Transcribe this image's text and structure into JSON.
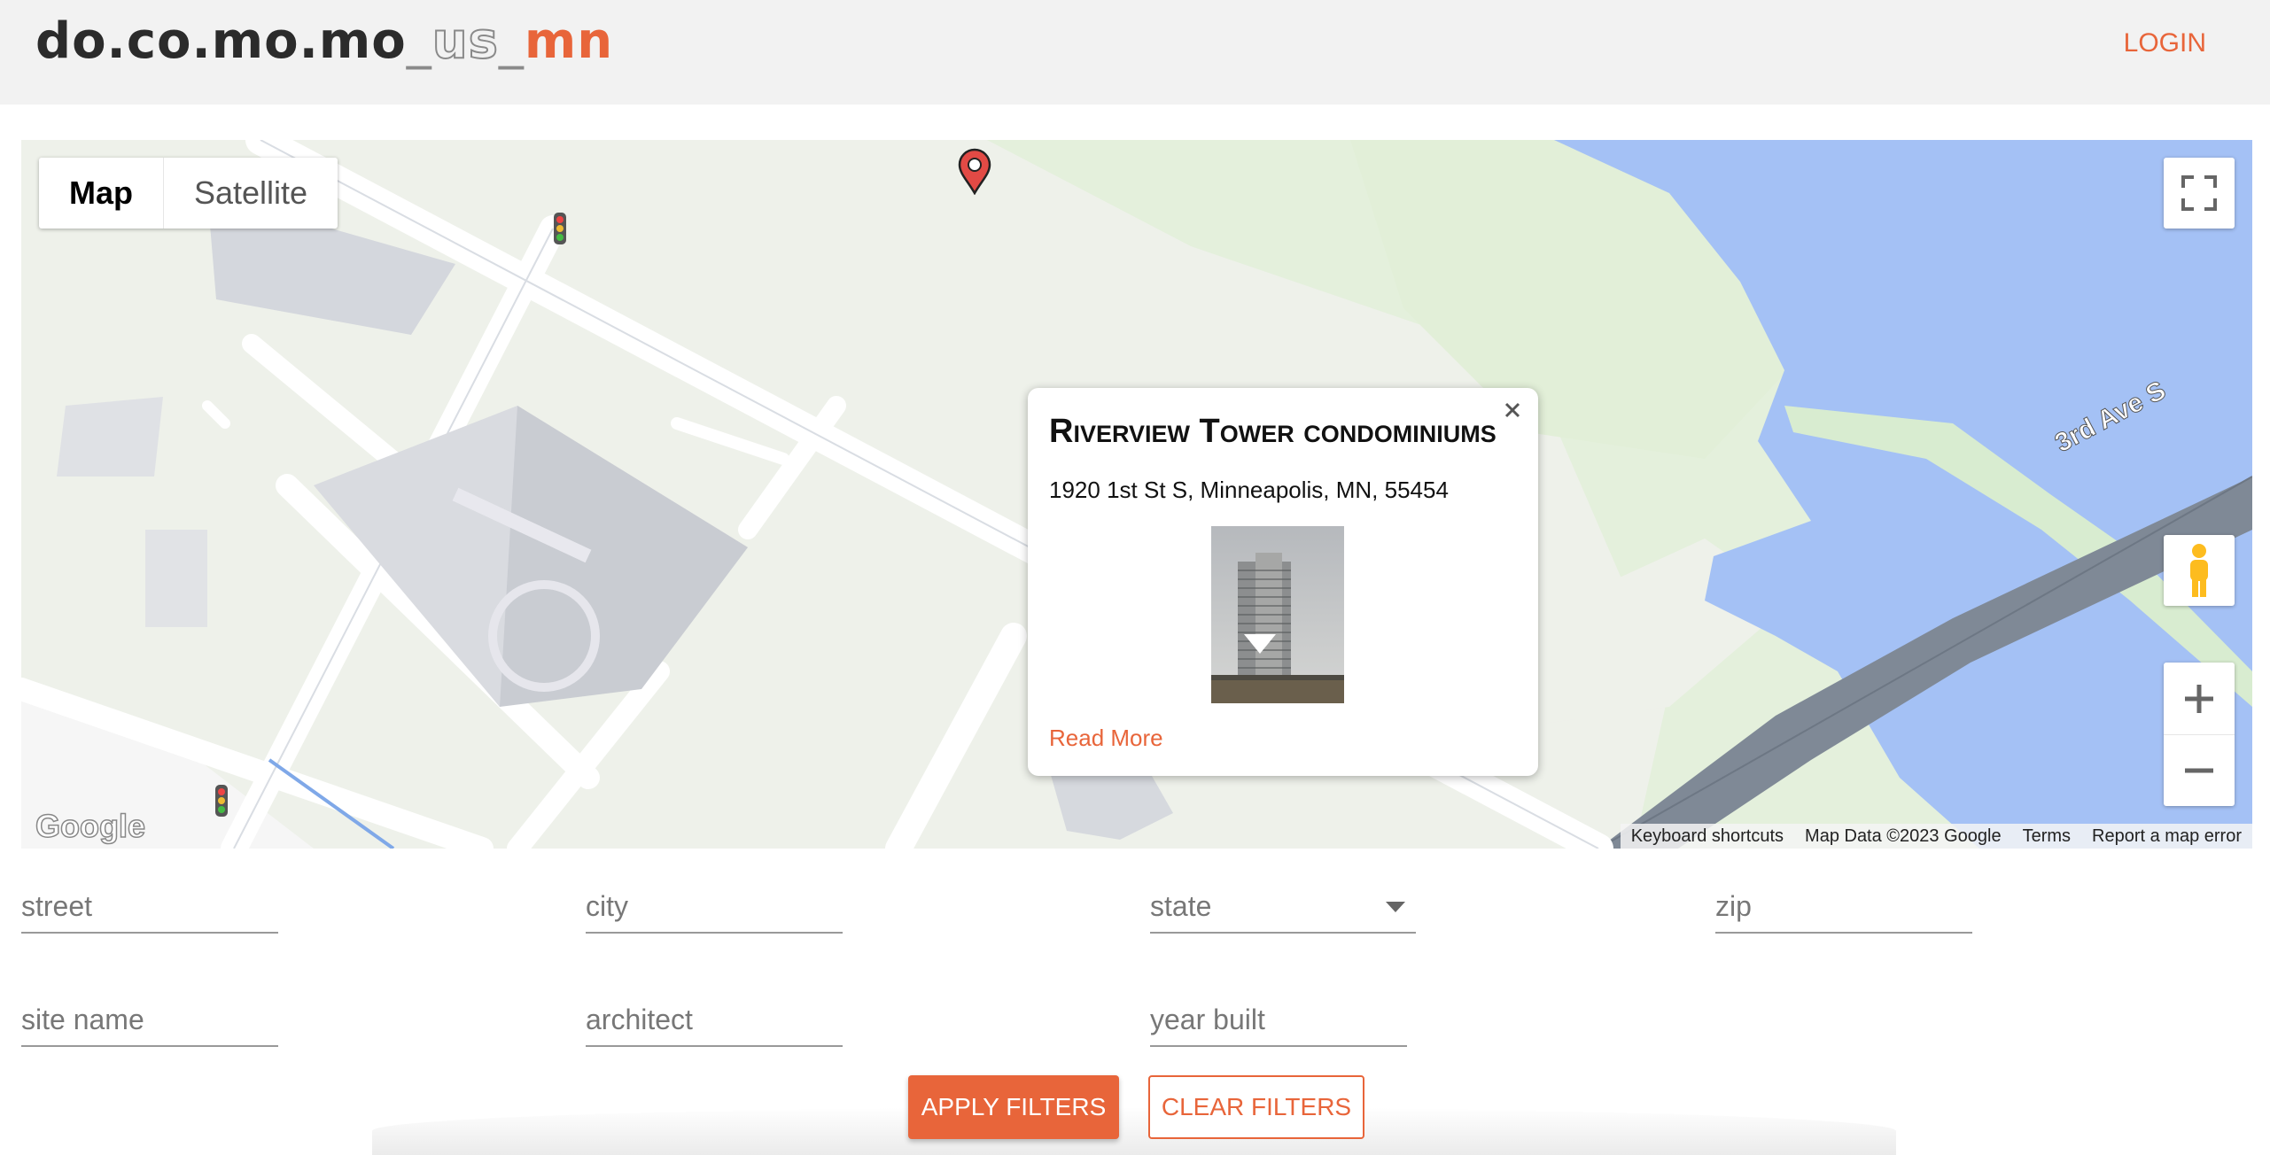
{
  "header": {
    "logo": {
      "docomomo": "do.co.mo.mo",
      "sep1": "_",
      "us": "us",
      "sep2": "_",
      "mn": "mn"
    },
    "login_label": "LOGIN"
  },
  "map": {
    "type_map": "Map",
    "type_satellite": "Satellite",
    "street_label": "3rd Ave S",
    "google_logo": "Google",
    "attribution": {
      "shortcuts": "Keyboard shortcuts",
      "data": "Map Data ©2023 Google",
      "terms": "Terms",
      "report": "Report a map error"
    },
    "colors": {
      "water": "#a4c1f5",
      "land": "#e4f0dc",
      "road": "#ffffff",
      "bridge": "#808a96"
    }
  },
  "infowindow": {
    "title": "Riverview Tower condominiums",
    "address": "1920 1st St S, Minneapolis, MN, 55454",
    "read_more": "Read More"
  },
  "filters": {
    "street": "street",
    "city": "city",
    "state": "state",
    "zip": "zip",
    "site_name": "site name",
    "architect": "architect",
    "year_built": "year built",
    "apply_label": "APPLY FILTERS",
    "clear_label": "CLEAR FILTERS"
  },
  "accent_color": "#e8653a"
}
